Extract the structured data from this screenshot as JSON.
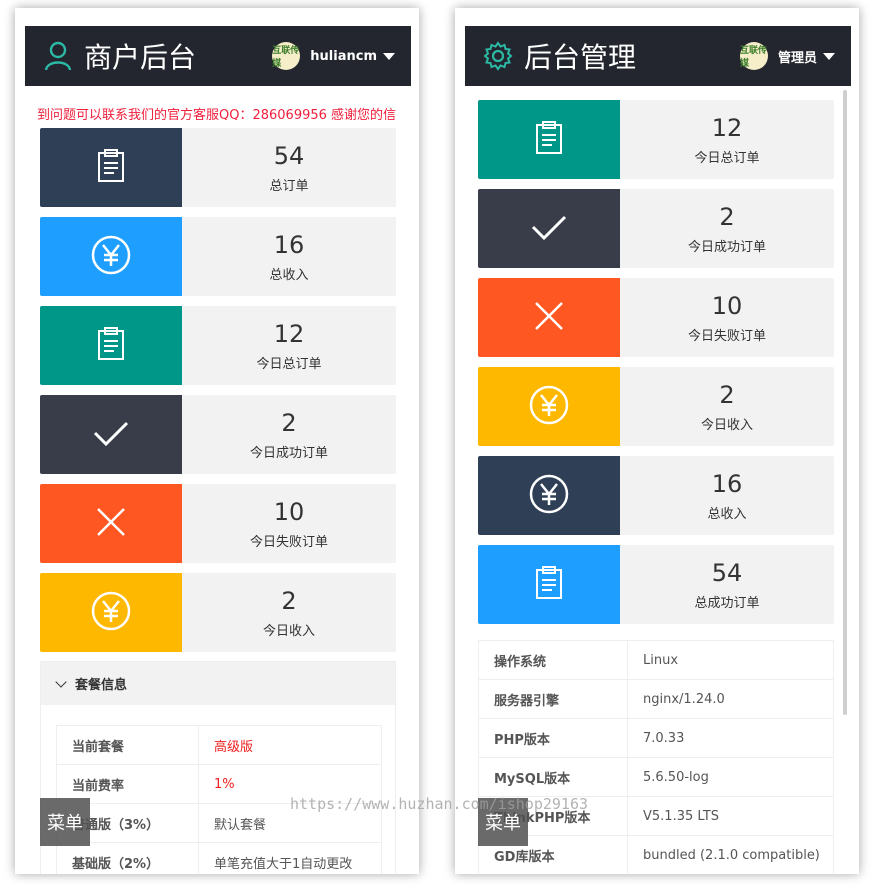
{
  "left": {
    "title": "商户后台",
    "username": "huliancm",
    "avatar_text": "互联传媒",
    "notice": "到问题可以联系我们的官方客服QQ：286069956 感谢您的信",
    "cards": [
      {
        "num": "54",
        "label": "总订单",
        "icon": "clipboard-icon",
        "color": "#2f4056"
      },
      {
        "num": "16",
        "label": "总收入",
        "icon": "yen-icon",
        "color": "#1e9fff"
      },
      {
        "num": "12",
        "label": "今日总订单",
        "icon": "clipboard-icon",
        "color": "#009688"
      },
      {
        "num": "2",
        "label": "今日成功订单",
        "icon": "check-icon",
        "color": "#393d49"
      },
      {
        "num": "10",
        "label": "今日失败订单",
        "icon": "close-icon",
        "color": "#ff5722"
      },
      {
        "num": "2",
        "label": "今日收入",
        "icon": "yen-icon",
        "color": "#ffb800"
      }
    ],
    "panel": {
      "title": "套餐信息",
      "rows": [
        {
          "k": "当前套餐",
          "v": "高级版"
        },
        {
          "k": "当前费率",
          "v": "1%"
        },
        {
          "k": "普通版（3%）",
          "v": "默认套餐"
        },
        {
          "k": "基础版（2%）",
          "v": "单笔充值大于1自动更改"
        }
      ]
    },
    "menu": "菜单"
  },
  "right": {
    "title": "后台管理",
    "username": "管理员",
    "avatar_text": "互联传媒",
    "cards": [
      {
        "num": "12",
        "label": "今日总订单",
        "icon": "clipboard-icon",
        "color": "#009688"
      },
      {
        "num": "2",
        "label": "今日成功订单",
        "icon": "check-icon",
        "color": "#393d49"
      },
      {
        "num": "10",
        "label": "今日失败订单",
        "icon": "close-icon",
        "color": "#ff5722"
      },
      {
        "num": "2",
        "label": "今日收入",
        "icon": "yen-icon",
        "color": "#ffb800"
      },
      {
        "num": "16",
        "label": "总收入",
        "icon": "yen-icon",
        "color": "#2f4056"
      },
      {
        "num": "54",
        "label": "总成功订单",
        "icon": "clipboard-icon",
        "color": "#1e9fff"
      }
    ],
    "sys": [
      {
        "k": "操作系统",
        "v": "Linux"
      },
      {
        "k": "服务器引擎",
        "v": "nginx/1.24.0"
      },
      {
        "k": "PHP版本",
        "v": "7.0.33"
      },
      {
        "k": "MySQL版本",
        "v": "5.6.50-log"
      },
      {
        "k": "ThinkPHP版本",
        "v": "V5.1.35 LTS"
      },
      {
        "k": "GD库版本",
        "v": "bundled (2.1.0 compatible)"
      }
    ],
    "menu": "菜单"
  },
  "watermark": "https://www.huzhan.com/ishop29163"
}
